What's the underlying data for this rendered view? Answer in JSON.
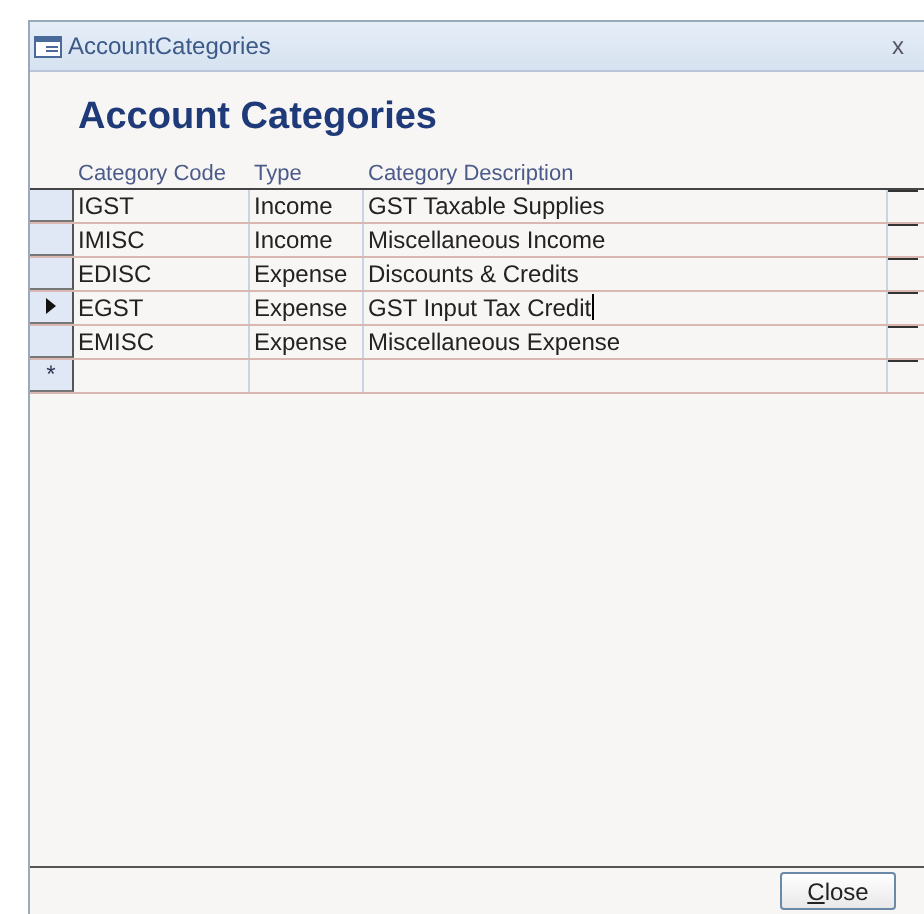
{
  "window": {
    "title": "AccountCategories",
    "close_glyph": "x"
  },
  "heading": "Account Categories",
  "table": {
    "columns": [
      "Category Code",
      "Type",
      "Category Description"
    ],
    "rows": [
      {
        "cells": [
          "IGST",
          "Income",
          "GST Taxable Supplies"
        ],
        "selected": false
      },
      {
        "cells": [
          "IMISC",
          "Income",
          "Miscellaneous Income"
        ],
        "selected": false
      },
      {
        "cells": [
          "EDISC",
          "Expense",
          "Discounts & Credits"
        ],
        "selected": false
      },
      {
        "cells": [
          "EGST",
          "Expense",
          "GST Input Tax Credit"
        ],
        "selected": true
      },
      {
        "cells": [
          "EMISC",
          "Expense",
          "Miscellaneous Expense"
        ],
        "selected": false
      }
    ],
    "new_record_marker": "*"
  },
  "close_button": {
    "label": "Close",
    "first_letter_underlined": true
  }
}
